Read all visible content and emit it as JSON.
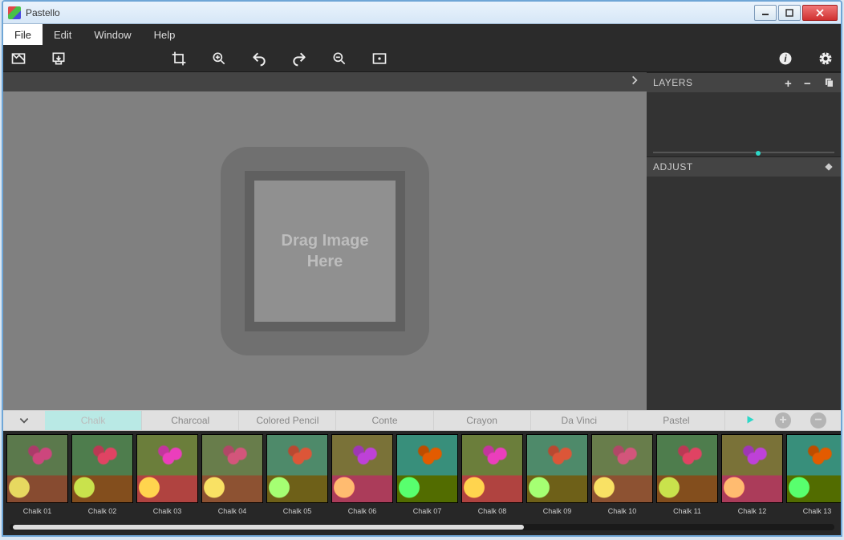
{
  "window": {
    "title": "Pastello"
  },
  "menu": {
    "items": [
      "File",
      "Edit",
      "Window",
      "Help"
    ],
    "active_index": 0
  },
  "canvas": {
    "drop_line1": "Drag Image",
    "drop_line2": "Here"
  },
  "panels": {
    "layers": {
      "title": "LAYERS"
    },
    "adjust": {
      "title": "ADJUST"
    }
  },
  "style_tabs": {
    "items": [
      "Chalk",
      "Charcoal",
      "Colored Pencil",
      "Conte",
      "Crayon",
      "Da Vinci",
      "Pastel"
    ],
    "active_index": 0
  },
  "presets": {
    "items": [
      {
        "label": "Chalk 01"
      },
      {
        "label": "Chalk 02"
      },
      {
        "label": "Chalk 03"
      },
      {
        "label": "Chalk 04"
      },
      {
        "label": "Chalk 05"
      },
      {
        "label": "Chalk 06"
      },
      {
        "label": "Chalk 07"
      },
      {
        "label": "Chalk 08"
      },
      {
        "label": "Chalk 09"
      },
      {
        "label": "Chalk 10"
      },
      {
        "label": "Chalk 11"
      },
      {
        "label": "Chalk 12"
      },
      {
        "label": "Chalk 13"
      }
    ]
  }
}
